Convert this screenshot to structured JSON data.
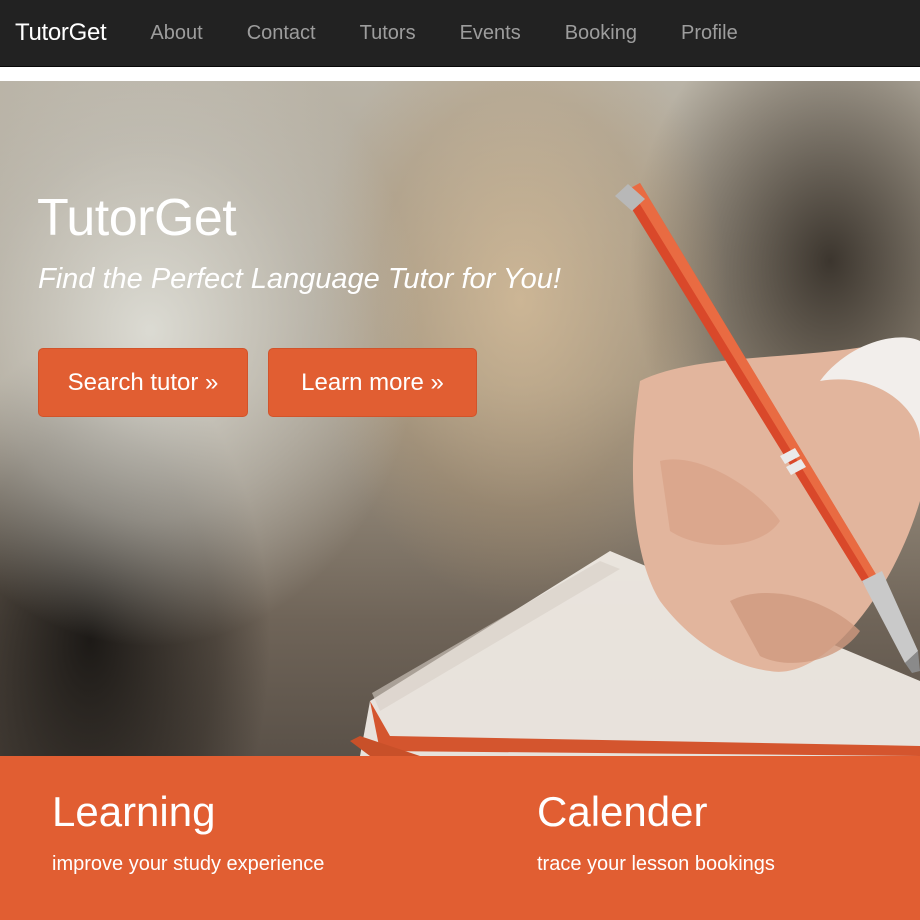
{
  "navbar": {
    "brand": "TutorGet",
    "links": [
      "About",
      "Contact",
      "Tutors",
      "Events",
      "Booking",
      "Profile"
    ]
  },
  "hero": {
    "title": "TutorGet",
    "tagline": "Find the Perfect Language Tutor for You!",
    "buttons": {
      "search": "Search tutor »",
      "learn": "Learn more »"
    }
  },
  "features": [
    {
      "title": "Learning",
      "text": "improve your study experience"
    },
    {
      "title": "Calender",
      "text": "trace your lesson bookings"
    }
  ],
  "colors": {
    "navbar_bg": "#222222",
    "accent": "#e15e32",
    "nav_link": "#9d9d9d"
  }
}
